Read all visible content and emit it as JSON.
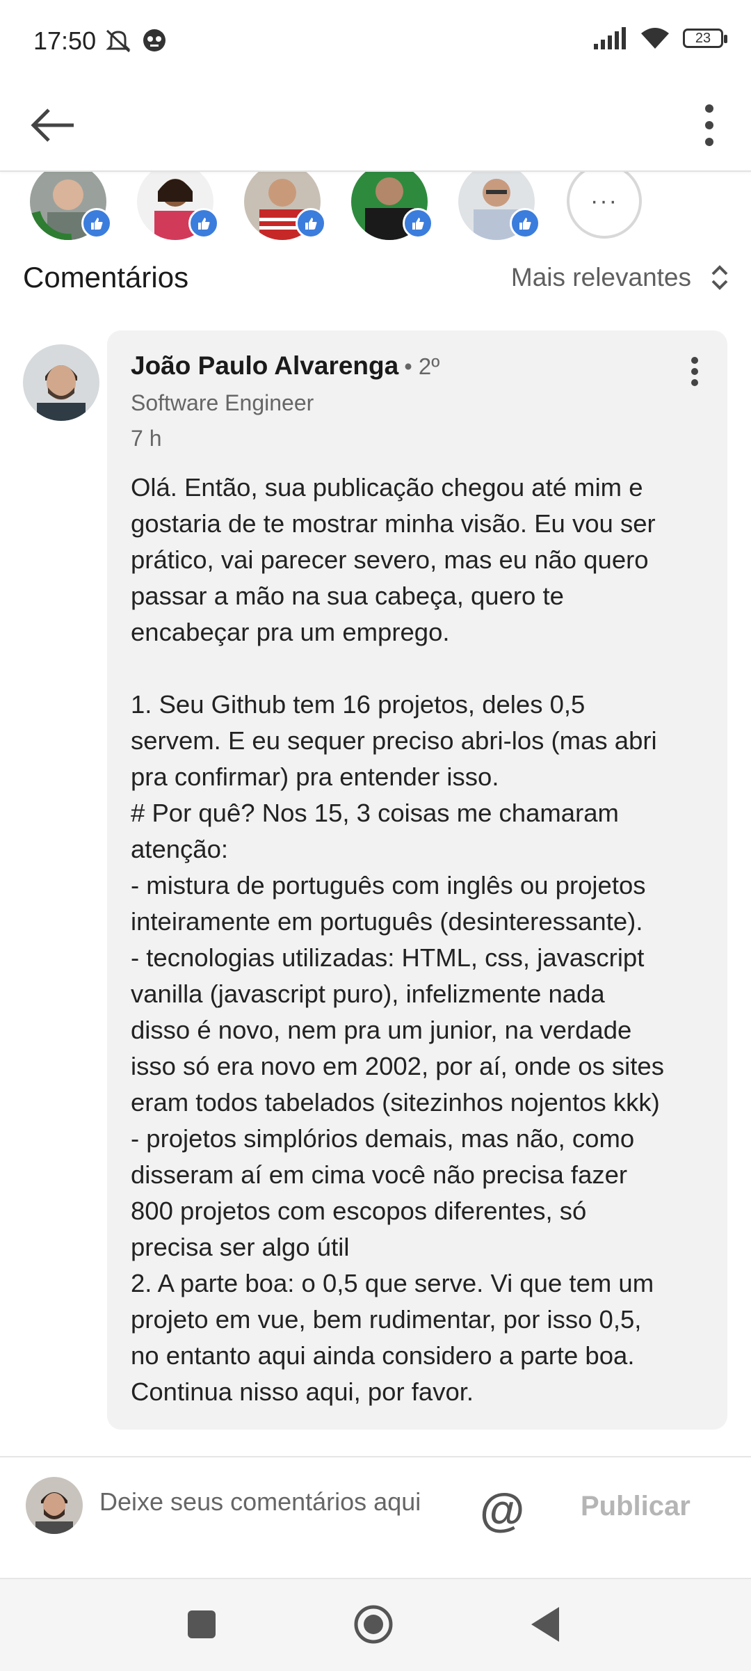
{
  "status_bar": {
    "time": "17:50",
    "battery": "23"
  },
  "comments_section": {
    "title": "Comentários",
    "sort_label": "Mais relevantes",
    "more_reactors_label": "···"
  },
  "comment": {
    "author": "João Paulo Alvarenga",
    "degree": "• 2º",
    "headline": "Software Engineer",
    "time": "7 h",
    "text": "Olá. Então, sua publicação chegou até mim e\ngostaria de te mostrar minha visão. Eu vou ser\nprático, vai parecer severo, mas eu não quero\npassar a mão na sua cabeça, quero te\nencabeçar pra um emprego.\n\n1. Seu Github tem 16 projetos, deles 0,5\nservem. E eu sequer preciso abri-los (mas abri\npra confirmar) pra entender isso.\n# Por quê? Nos 15, 3 coisas me chamaram\natenção:\n- mistura de português com inglês ou projetos\ninteiramente em português (desinteressante).\n- tecnologias utilizadas: HTML, css, javascript\nvanilla (javascript puro), infelizmente nada\ndisso é novo, nem pra um junior, na verdade\nisso só era novo em 2002, por aí, onde os sites\neram todos tabelados (sitezinhos nojentos kkk)\n- projetos simplórios demais, mas não, como\ndisseram aí em cima você não precisa fazer\n800 projetos com escopos diferentes, só\nprecisa ser algo útil\n2. A parte boa: o 0,5 que serve. Vi que tem um\nprojeto em vue, bem rudimentar, por isso 0,5,\nno entanto aqui ainda considero a parte boa.\nContinua nisso aqui, por favor."
  },
  "input_bar": {
    "placeholder": "Deixe seus comentários aqui",
    "mention_symbol": "@",
    "publish_label": "Publicar"
  },
  "colors": {
    "like_badge": "#3b7ddd",
    "bubble_bg": "#f2f2f2",
    "publish_disabled": "#b5b5b5"
  }
}
